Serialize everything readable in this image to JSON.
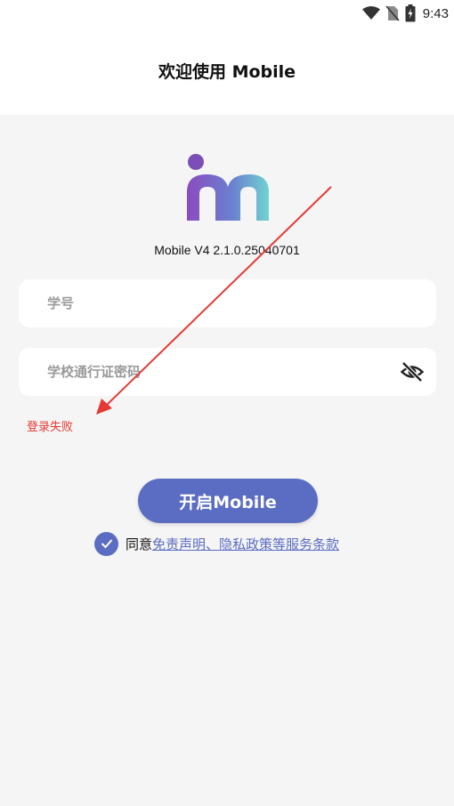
{
  "status_bar": {
    "time": "9:43",
    "icons": [
      "wifi-icon",
      "no-sim-icon",
      "battery-charging-icon"
    ]
  },
  "header": {
    "title": "欢迎使用 Mobile"
  },
  "logo": {
    "icon": "app-logo-m",
    "colors": {
      "dot": "#7b4fb5",
      "gradient_start": "#8a4bbf",
      "gradient_end": "#6fd3d0"
    }
  },
  "version": "Mobile V4 2.1.0.25040701",
  "form": {
    "student_id": {
      "placeholder": "学号",
      "value": ""
    },
    "password": {
      "placeholder": "学校通行证密码",
      "value": "",
      "toggle_icon": "eye-off-icon"
    },
    "error": "登录失败"
  },
  "start_button": {
    "label": "开启Mobile"
  },
  "agreement": {
    "checked": true,
    "prefix": "同意",
    "link": "免责声明、隐私政策等服务条款"
  },
  "colors": {
    "accent": "#5b6dc2",
    "error": "#e53935",
    "background": "#f5f5f5",
    "annotation_arrow": "#e53935"
  }
}
